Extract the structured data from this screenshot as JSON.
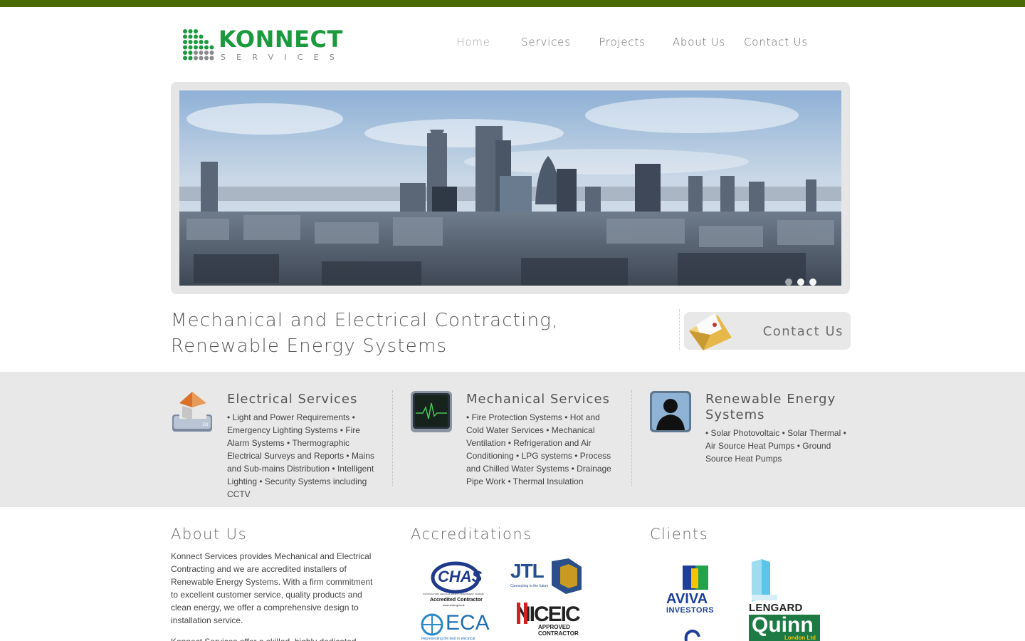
{
  "colors": {
    "topbar": "#4a6a04",
    "brand_green": "#1a9a3c",
    "band_bg": "#e8e8e8"
  },
  "logo": {
    "name": "KONNECT",
    "sub": "SERVICES"
  },
  "nav": [
    {
      "label": "Home",
      "active": true
    },
    {
      "label": "Services"
    },
    {
      "label": "Projects"
    },
    {
      "label": "About Us"
    },
    {
      "label": "Contact Us"
    }
  ],
  "slider": {
    "image": "city-skyline-photo",
    "dots": 3,
    "active_dot": 2
  },
  "tagline": {
    "line1": "Mechanical and Electrical Contracting,",
    "line2": "Renewable Energy Systems"
  },
  "contact_box": {
    "label": "Contact Us",
    "icon": "envelope-icon"
  },
  "services": [
    {
      "icon": "house-3d-icon",
      "title": "Electrical Services",
      "text": "• Light and Power Requirements • Emergency Lighting Systems • Fire Alarm Systems • Thermographic Electrical Surveys and Reports • Mains and Sub-mains Distribution • Intelligent Lighting • Security Systems including CCTV"
    },
    {
      "icon": "heartbeat-monitor-icon",
      "title": "Mechanical Services",
      "text": "• Fire Protection Systems • Hot and Cold Water Services • Mechanical Ventilation • Refrigeration and Air Conditioning • LPG systems • Process and Chilled Water Systems • Drainage Pipe Work • Thermal Insulation"
    },
    {
      "icon": "person-silhouette-icon",
      "title": "Renewable Energy Systems",
      "text": "• Solar Photovoltaic • Solar Thermal • Air Source Heat Pumps • Ground Source Heat Pumps"
    }
  ],
  "about": {
    "title": "About Us",
    "text": "Konnect Services provides Mechanical and Electrical Contracting and we are accredited installers of Renewable Energy Systems. With a firm commitment to excellent customer service, quality products and clean energy, we offer a comprehensive design to installation service.",
    "text2": "Konnect Services offer a skilled, highly dedicated"
  },
  "accreditations": {
    "title": "Accreditations",
    "logos": [
      {
        "name": "CHAS",
        "caption": "Accredited Contractor",
        "url_text": "www.chas.gov.uk",
        "tiny": "CONTRACTORS HEALTH & SAFETY ASSESSMENT SCHEME"
      },
      {
        "name": "JTL",
        "caption": "Connecting to the future"
      },
      {
        "name": "ECA",
        "caption": "Representing the best in electrical"
      },
      {
        "name": "NICEIC",
        "caption": "APPROVED CONTRACTOR"
      }
    ]
  },
  "clients": {
    "title": "Clients",
    "logos": [
      {
        "name": "AVIVA",
        "caption": "INVESTORS"
      },
      {
        "name": "LENGARD"
      },
      {
        "name": "Quinn",
        "caption": "London Ltd"
      }
    ]
  }
}
